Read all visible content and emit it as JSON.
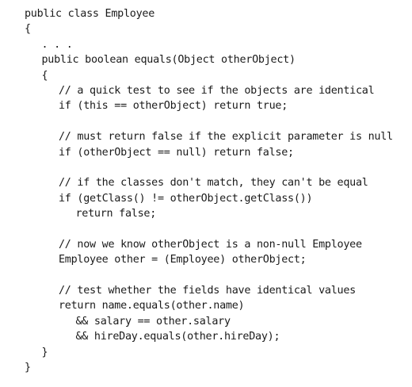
{
  "code": {
    "lines": [
      {
        "indent": 0,
        "text": "public class Employee"
      },
      {
        "indent": 0,
        "text": "{"
      },
      {
        "indent": 1,
        "text": ". . ."
      },
      {
        "indent": 1,
        "text": "public boolean equals(Object otherObject)"
      },
      {
        "indent": 1,
        "text": "{"
      },
      {
        "indent": 2,
        "text": "// a quick test to see if the objects are identical"
      },
      {
        "indent": 2,
        "text": "if (this == otherObject) return true;"
      },
      {
        "indent": 0,
        "text": ""
      },
      {
        "indent": 2,
        "text": "// must return false if the explicit parameter is null"
      },
      {
        "indent": 2,
        "text": "if (otherObject == null) return false;"
      },
      {
        "indent": 0,
        "text": ""
      },
      {
        "indent": 2,
        "text": "// if the classes don't match, they can't be equal"
      },
      {
        "indent": 2,
        "text": "if (getClass() != otherObject.getClass())"
      },
      {
        "indent": 3,
        "text": "return false;"
      },
      {
        "indent": 0,
        "text": ""
      },
      {
        "indent": 2,
        "text": "// now we know otherObject is a non-null Employee"
      },
      {
        "indent": 2,
        "text": "Employee other = (Employee) otherObject;"
      },
      {
        "indent": 0,
        "text": ""
      },
      {
        "indent": 2,
        "text": "// test whether the fields have identical values"
      },
      {
        "indent": 2,
        "text": "return name.equals(other.name)"
      },
      {
        "indent": 3,
        "text": "&& salary == other.salary"
      },
      {
        "indent": 3,
        "text": "&& hireDay.equals(other.hireDay);"
      },
      {
        "indent": 1,
        "text": "}"
      },
      {
        "indent": 0,
        "text": "}"
      }
    ]
  }
}
